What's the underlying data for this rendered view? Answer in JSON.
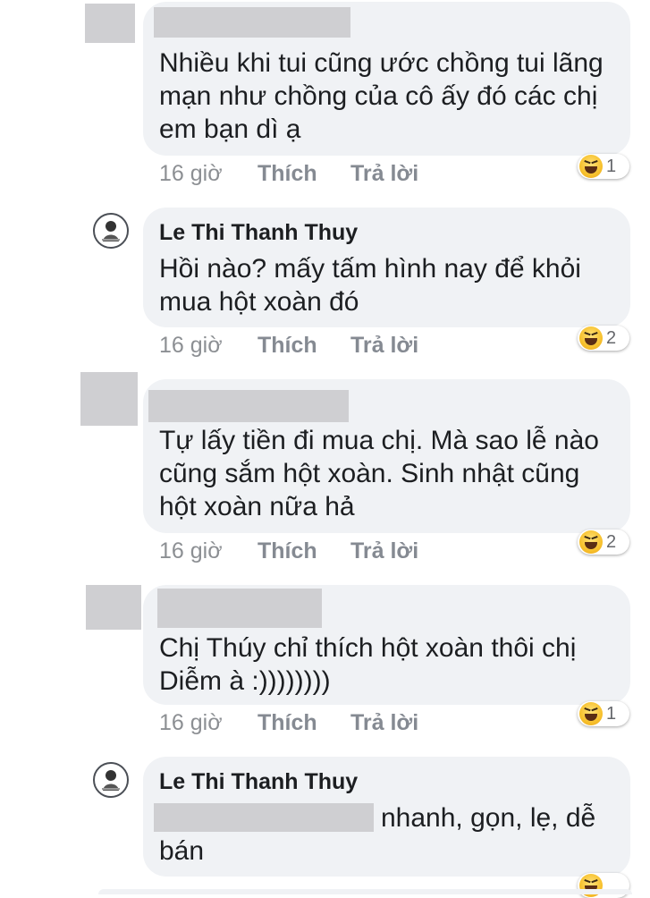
{
  "comments": [
    {
      "author": "",
      "text": "Nhiều khi tui cũng ước chồng tui lãng\nmạn như chồng của cô ấy đó các chị\nem bạn dì ạ",
      "time": "16 giờ",
      "like": "Thích",
      "reply": "Trả lời",
      "reaction_icon": "haha-icon",
      "reaction_count": "1"
    },
    {
      "author": "Le Thi Thanh Thuy",
      "text": "Hồi nào? mấy tấm hình nay để khỏi\nmua hột xoàn đó",
      "time": "16 giờ",
      "like": "Thích",
      "reply": "Trả lời",
      "reaction_icon": "haha-icon",
      "reaction_count": "2"
    },
    {
      "author": "",
      "text": "Tự lấy tiền đi mua chị. Mà sao lễ nào\ncũng sắm hột xoàn. Sinh nhật cũng\nhột xoàn nữa hả",
      "time": "16 giờ",
      "like": "Thích",
      "reply": "Trả lời",
      "reaction_icon": "haha-icon",
      "reaction_count": "2"
    },
    {
      "author": "",
      "text": "Chị Thúy chỉ thích hột xoàn thôi chị\nDiễm à :))))))))",
      "time": "16 giờ",
      "like": "Thích",
      "reply": "Trả lời",
      "reaction_icon": "haha-icon",
      "reaction_count": "1"
    },
    {
      "author": "Le Thi Thanh Thuy",
      "text_visible": "nhanh, gọn, lẹ, dễ",
      "text_line2": "bán"
    }
  ],
  "colors": {
    "bubble": "#f0f2f5",
    "meta_text": "#8c8f93",
    "redaction": "#cfcfd2"
  }
}
